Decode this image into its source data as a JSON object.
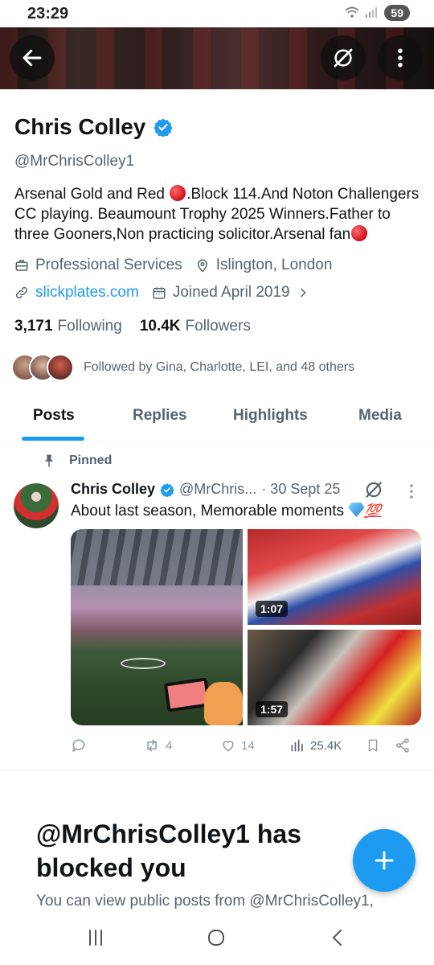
{
  "status_bar": {
    "time": "23:29",
    "battery": "59"
  },
  "profile": {
    "name": "Chris Colley",
    "handle": "@MrChrisColley1",
    "bio_parts": [
      "Arsenal Gold and Red ",
      ".Block 114.And Noton Challengers CC playing. Beaumount Trophy 2025 Winners.Father to three Gooners,Non practicing solicitor.Arsenal fan"
    ],
    "category": "Professional Services",
    "location": "Islington, London",
    "website": "slickplates.com",
    "joined": "Joined April 2019",
    "following_count": "3,171",
    "following_label": "Following",
    "followers_count": "10.4K",
    "followers_label": "Followers",
    "followed_by": "Followed by Gina, Charlotte, LEI, and 48 others"
  },
  "tabs": [
    {
      "label": "Posts",
      "active": true
    },
    {
      "label": "Replies",
      "active": false
    },
    {
      "label": "Highlights",
      "active": false
    },
    {
      "label": "Media",
      "active": false
    }
  ],
  "pinned_post": {
    "pinned_label": "Pinned",
    "author": "Chris Colley",
    "handle": "@MrChris...",
    "date": "· 30 Sept 25",
    "text": "About last season, Memorable moments ",
    "emoji_100": "💯",
    "media": [
      {
        "type": "image"
      },
      {
        "type": "video",
        "duration": "1:07"
      },
      {
        "type": "video",
        "duration": "1:57"
      }
    ],
    "replies": "",
    "reposts": "4",
    "likes": "14",
    "views": "25.4K"
  },
  "blocked": {
    "title": "@MrChrisColley1 has blocked you",
    "subtitle": "You can view public posts from @MrChrisColley1,"
  },
  "colors": {
    "accent": "#1d9bf0",
    "text": "#0f1419",
    "muted": "#536471"
  }
}
